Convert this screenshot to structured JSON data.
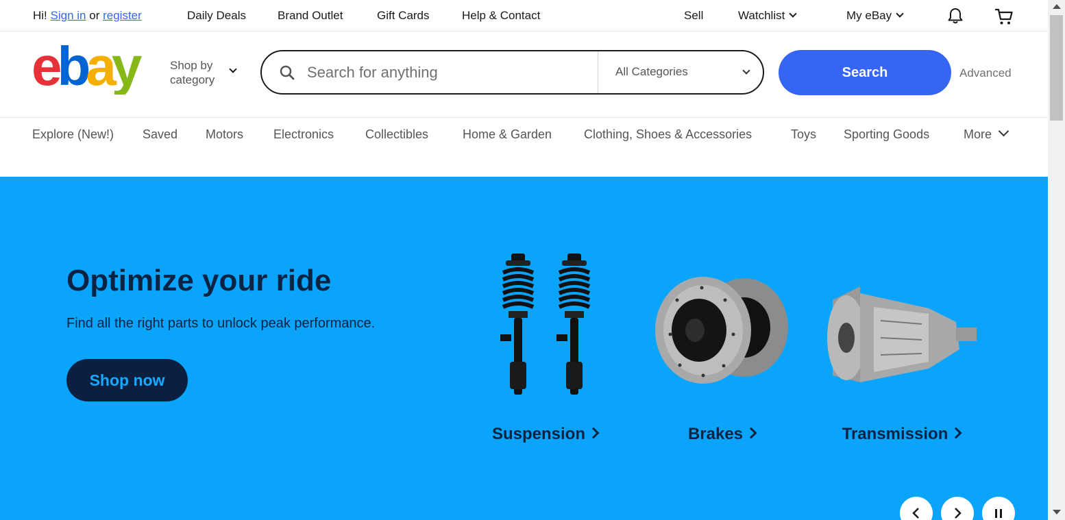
{
  "topbar": {
    "greeting": "Hi!",
    "sign_in": "Sign in",
    "or": "or",
    "register": "register",
    "links": [
      "Daily Deals",
      "Brand Outlet",
      "Gift Cards",
      "Help & Contact"
    ],
    "sell": "Sell",
    "watchlist": "Watchlist",
    "my_ebay": "My eBay",
    "bell_icon": "notification-bell-icon",
    "cart_icon": "shopping-cart-icon"
  },
  "header": {
    "logo_letters": [
      "e",
      "b",
      "a",
      "y"
    ],
    "logo_colors": [
      "#e53238",
      "#0064d2",
      "#f5af02",
      "#86b817"
    ],
    "shop_by_line1": "Shop by",
    "shop_by_line2": "category",
    "search_placeholder": "Search for anything",
    "category_select": "All Categories",
    "search_button": "Search",
    "advanced": "Advanced"
  },
  "catnav": {
    "items": [
      "Explore (New!)",
      "Saved",
      "Motors",
      "Electronics",
      "Collectibles",
      "Home & Garden",
      "Clothing, Shoes & Accessories",
      "Toys",
      "Sporting Goods",
      "More"
    ]
  },
  "hero": {
    "title": "Optimize your ride",
    "subtitle": "Find all the right parts to unlock peak performance.",
    "cta": "Shop now",
    "background": "#0aa4fb",
    "tiles": [
      {
        "label": "Suspension",
        "icon": "suspension-struts-image"
      },
      {
        "label": "Brakes",
        "icon": "brake-rotors-image"
      },
      {
        "label": "Transmission",
        "icon": "transmission-image"
      }
    ],
    "controls": [
      "previous-slide-icon",
      "next-slide-icon",
      "pause-icon"
    ]
  }
}
